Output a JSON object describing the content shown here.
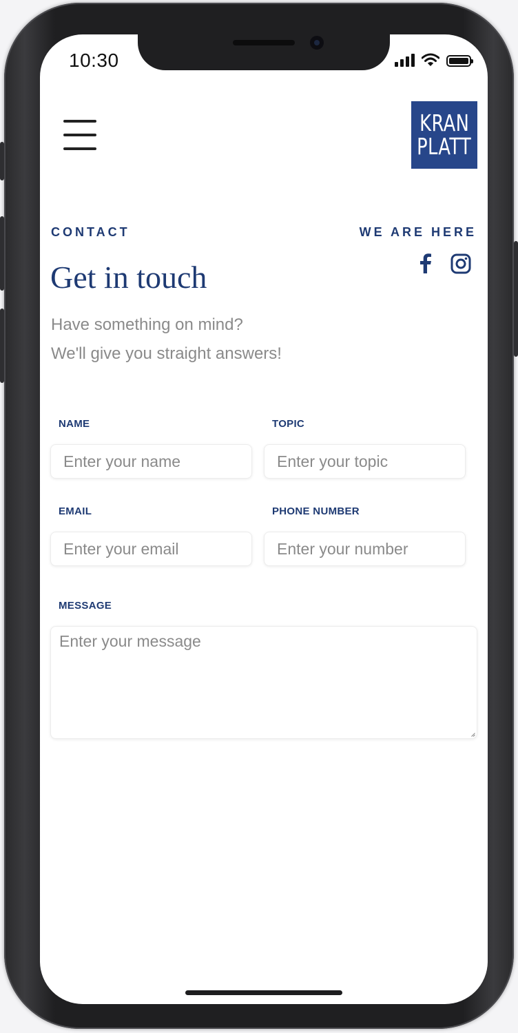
{
  "status_bar": {
    "time": "10:30"
  },
  "header": {
    "menu_icon": "hamburger-menu-icon",
    "logo": {
      "line1": "KRAN",
      "line2": "PLATT",
      "background": "#27468a"
    }
  },
  "contact": {
    "eyebrow": "CONTACT",
    "title": "Get in touch",
    "subtitle_line1": "Have something on mind?",
    "subtitle_line2": "We'll give you straight answers!"
  },
  "social": {
    "heading": "WE ARE HERE",
    "icons": [
      "facebook-icon",
      "instagram-icon"
    ]
  },
  "form": {
    "name": {
      "label": "NAME",
      "placeholder": "Enter your name",
      "value": ""
    },
    "topic": {
      "label": "TOPIC",
      "placeholder": "Enter your topic",
      "value": ""
    },
    "email": {
      "label": "EMAIL",
      "placeholder": "Enter your email",
      "value": ""
    },
    "phone": {
      "label": "PHONE NUMBER",
      "placeholder": "Enter your number",
      "value": ""
    },
    "message": {
      "label": "MESSAGE",
      "placeholder": "Enter your message",
      "value": ""
    }
  },
  "colors": {
    "accent": "#1e3a73",
    "logo_bg": "#27468a",
    "muted_text": "#8a8a8a"
  }
}
